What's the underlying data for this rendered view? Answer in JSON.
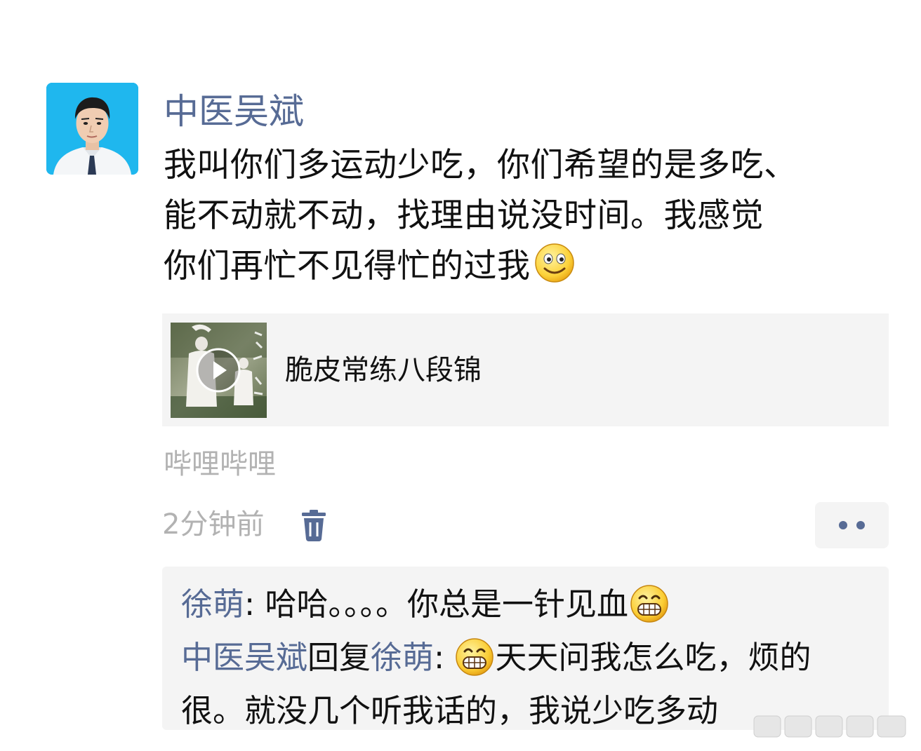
{
  "post": {
    "author": "中医吴斌",
    "text_lines": [
      "我叫你们多运动少吃，你们希望的是多吃、",
      "能不动就不动，找理由说没时间。我感觉",
      "你们再忙不见得忙的过我"
    ],
    "text_emoji": "smile-emoji",
    "link": {
      "title": "脆皮常练八段锦",
      "thumbnail": "video-thumbnail"
    },
    "source": "哔哩哔哩",
    "time": "2分钟前",
    "icons": {
      "delete": "trash-icon",
      "more": "more-dots-icon"
    }
  },
  "comments": [
    {
      "author": "徐萌",
      "sep": ": ",
      "text": "哈哈。。。。你总是一针见血",
      "emoji": "grin-emoji"
    },
    {
      "author": "中医吴斌",
      "reply_word": "回复",
      "reply_to": "徐萌",
      "sep": ": ",
      "emoji": "grin-emoji",
      "text_line1": "天天问我怎么吃，烦的",
      "text_line2": "很。就没几个听我话的，我说少吃多动"
    }
  ],
  "colors": {
    "name_link": "#576b95",
    "meta_gray": "#b2b2b2",
    "card_bg": "#f4f4f4",
    "avatar_bg": "#1fb7ee"
  }
}
